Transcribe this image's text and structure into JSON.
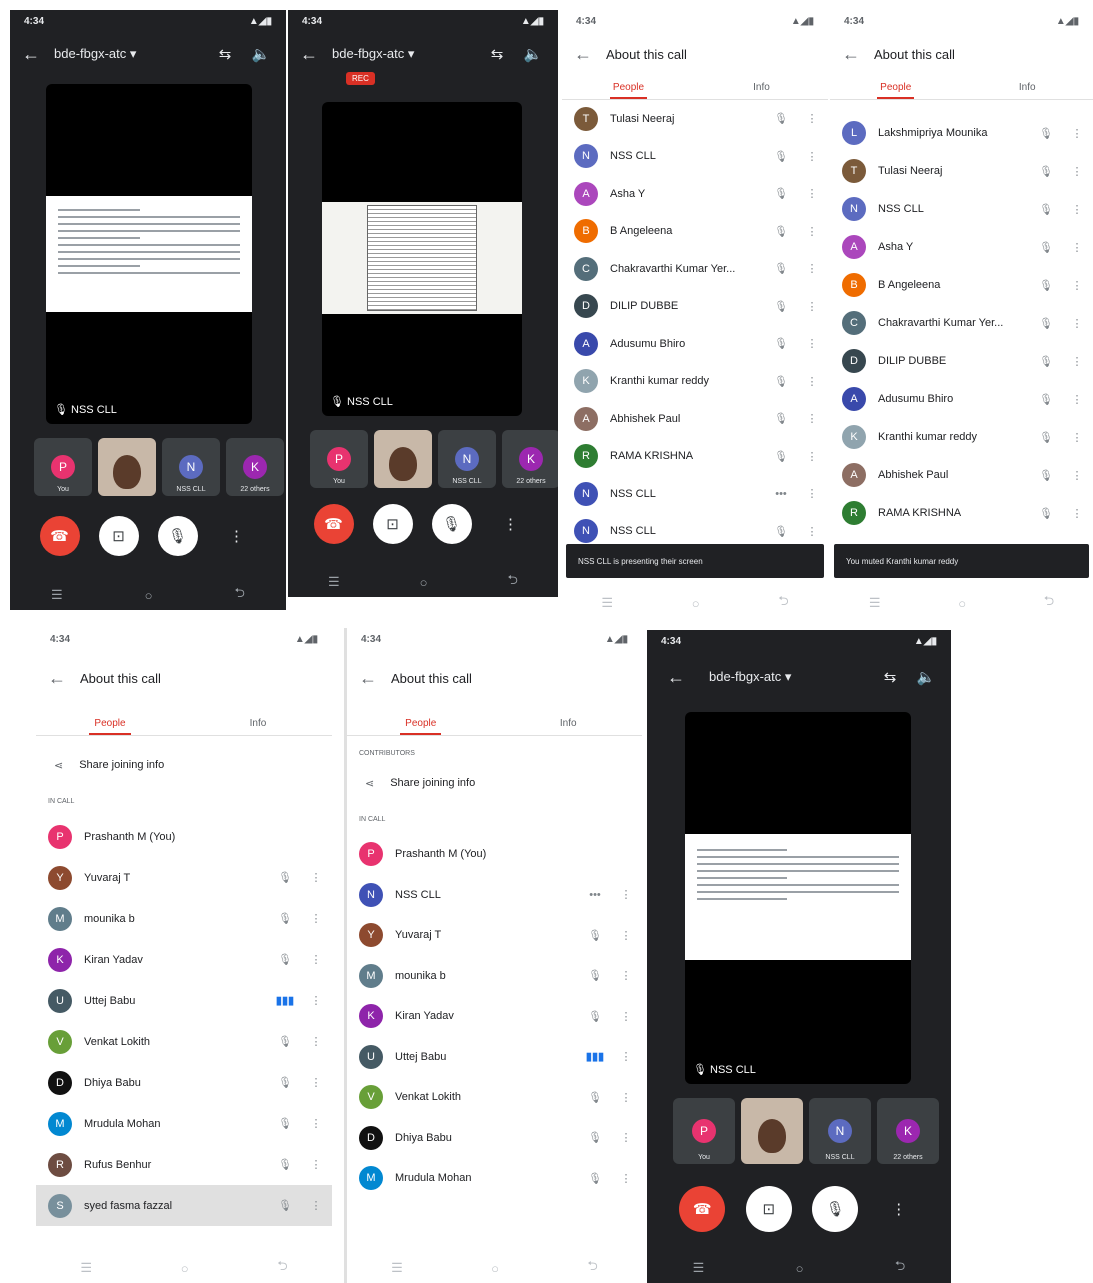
{
  "call": {
    "code": "bde-fbgx-atc",
    "stage_label": "NSS CLL",
    "rec_badge": "REC"
  },
  "status": {
    "time": "4:34",
    "icons": "▲◢▮"
  },
  "icons": {
    "back": "←",
    "switch_cam": "⇆",
    "speaker": "🔈",
    "dropdown": "▾",
    "end": "☎",
    "captions": "⊡",
    "mic": "🎙",
    "more": "⋮",
    "nav_recents": "☰",
    "nav_home": "○",
    "nav_back": "⮌",
    "share": "⋖"
  },
  "tiles": [
    {
      "initial": "P",
      "color": "#e8336f",
      "label": "You"
    },
    {
      "initial": "",
      "color": "",
      "label": ""
    },
    {
      "initial": "N",
      "color": "#5c6bc0",
      "label": "NSS CLL"
    },
    {
      "initial": "K",
      "color": "#9c27b0",
      "label": "22 others"
    }
  ],
  "about": {
    "title": "About this call",
    "tab_people": "People",
    "tab_info": "Info",
    "share_info": "Share joining info",
    "section_contributors": "CONTRIBUTORS",
    "section_in_call": "IN CALL"
  },
  "panel3": {
    "rows": [
      {
        "name": "Tulasi Neeraj",
        "initial": "T",
        "color": "#7b5a3a",
        "mic": "🎙"
      },
      {
        "name": "NSS CLL",
        "initial": "N",
        "color": "#5c6bc0",
        "mic": "🎙"
      },
      {
        "name": "Asha Y",
        "initial": "A",
        "color": "#ab47bc",
        "mic": "🎙"
      },
      {
        "name": "B Angeleena",
        "initial": "B",
        "color": "#ef6c00",
        "mic": "🎙"
      },
      {
        "name": "Chakravarthi Kumar Yer...",
        "initial": "C",
        "color": "#546e7a",
        "mic": "🎙"
      },
      {
        "name": "DILIP DUBBE",
        "initial": "D",
        "color": "#37474f",
        "mic": "🎙"
      },
      {
        "name": "Adusumu Bhiro",
        "initial": "A",
        "color": "#3949ab",
        "mic": "🎙"
      },
      {
        "name": "Kranthi kumar reddy",
        "initial": "K",
        "color": "#90a4ae",
        "mic": "🎙"
      },
      {
        "name": "Abhishek Paul",
        "initial": "A",
        "color": "#8d6e63",
        "mic": "🎙"
      },
      {
        "name": "RAMA KRISHNA",
        "initial": "R",
        "color": "#2e7d32",
        "mic": "🎙"
      },
      {
        "name": "NSS CLL",
        "initial": "N",
        "color": "#3f51b5",
        "mic": "•••"
      },
      {
        "name": "NSS CLL",
        "initial": "N",
        "color": "#3f51b5",
        "mic": "🎙"
      }
    ],
    "toast": "NSS CLL is presenting their screen"
  },
  "panel4": {
    "rows": [
      {
        "name": "Lakshmipriya Mounika",
        "initial": "L",
        "color": "#5c6bc0",
        "mic": "🎙"
      },
      {
        "name": "Tulasi Neeraj",
        "initial": "T",
        "color": "#7b5a3a",
        "mic": "🎙"
      },
      {
        "name": "NSS CLL",
        "initial": "N",
        "color": "#5c6bc0",
        "mic": "🎙"
      },
      {
        "name": "Asha Y",
        "initial": "A",
        "color": "#ab47bc",
        "mic": "🎙"
      },
      {
        "name": "B Angeleena",
        "initial": "B",
        "color": "#ef6c00",
        "mic": "🎙"
      },
      {
        "name": "Chakravarthi Kumar Yer...",
        "initial": "C",
        "color": "#546e7a",
        "mic": "🎙"
      },
      {
        "name": "DILIP DUBBE",
        "initial": "D",
        "color": "#37474f",
        "mic": "🎙"
      },
      {
        "name": "Adusumu Bhiro",
        "initial": "A",
        "color": "#3949ab",
        "mic": "🎙"
      },
      {
        "name": "Kranthi kumar reddy",
        "initial": "K",
        "color": "#90a4ae",
        "mic": "🎙"
      },
      {
        "name": "Abhishek Paul",
        "initial": "A",
        "color": "#8d6e63",
        "mic": "🎙"
      },
      {
        "name": "RAMA KRISHNA",
        "initial": "R",
        "color": "#2e7d32",
        "mic": "🎙"
      }
    ],
    "toast": "You muted Kranthi kumar reddy"
  },
  "panel5": {
    "rows": [
      {
        "name": "Prashanth M (You)",
        "initial": "P",
        "color": "#e8336f",
        "mic": "",
        "dots": ""
      },
      {
        "name": "Yuvaraj T",
        "initial": "Y",
        "color": "#8d4a2f",
        "mic": "🎙",
        "dots": "⋮"
      },
      {
        "name": "mounika b",
        "initial": "M",
        "color": "#607d8b",
        "mic": "🎙",
        "dots": "⋮"
      },
      {
        "name": "Kiran Yadav",
        "initial": "K",
        "color": "#8e24aa",
        "mic": "🎙",
        "dots": "⋮"
      },
      {
        "name": "Uttej Babu",
        "initial": "U",
        "color": "#455a64",
        "mic": "▮▮▮",
        "dots": "⋮",
        "speak": true
      },
      {
        "name": "Venkat Lokith",
        "initial": "V",
        "color": "#689f38",
        "mic": "🎙",
        "dots": "⋮"
      },
      {
        "name": "Dhiya Babu",
        "initial": "D",
        "color": "#111111",
        "mic": "🎙",
        "dots": "⋮"
      },
      {
        "name": "Mrudula Mohan",
        "initial": "M",
        "color": "#0288d1",
        "mic": "🎙",
        "dots": "⋮"
      },
      {
        "name": "Rufus Benhur",
        "initial": "R",
        "color": "#6d4c41",
        "mic": "🎙",
        "dots": "⋮"
      },
      {
        "name": "syed fasma fazzal",
        "initial": "S",
        "color": "#78909c",
        "mic": "🎙",
        "dots": "⋮",
        "hl": true
      }
    ]
  },
  "panel6": {
    "rows": [
      {
        "name": "Prashanth M (You)",
        "initial": "P",
        "color": "#e8336f",
        "mic": "",
        "dots": ""
      },
      {
        "name": "NSS CLL",
        "initial": "N",
        "color": "#3f51b5",
        "mic": "•••",
        "dots": "⋮"
      },
      {
        "name": "Yuvaraj T",
        "initial": "Y",
        "color": "#8d4a2f",
        "mic": "🎙",
        "dots": "⋮"
      },
      {
        "name": "mounika b",
        "initial": "M",
        "color": "#607d8b",
        "mic": "🎙",
        "dots": "⋮"
      },
      {
        "name": "Kiran Yadav",
        "initial": "K",
        "color": "#8e24aa",
        "mic": "🎙",
        "dots": "⋮"
      },
      {
        "name": "Uttej Babu",
        "initial": "U",
        "color": "#455a64",
        "mic": "▮▮▮",
        "dots": "⋮",
        "speak": true
      },
      {
        "name": "Venkat Lokith",
        "initial": "V",
        "color": "#689f38",
        "mic": "🎙",
        "dots": "⋮"
      },
      {
        "name": "Dhiya Babu",
        "initial": "D",
        "color": "#111111",
        "mic": "🎙",
        "dots": "⋮"
      },
      {
        "name": "Mrudula Mohan",
        "initial": "M",
        "color": "#0288d1",
        "mic": "🎙",
        "dots": "⋮"
      }
    ]
  }
}
